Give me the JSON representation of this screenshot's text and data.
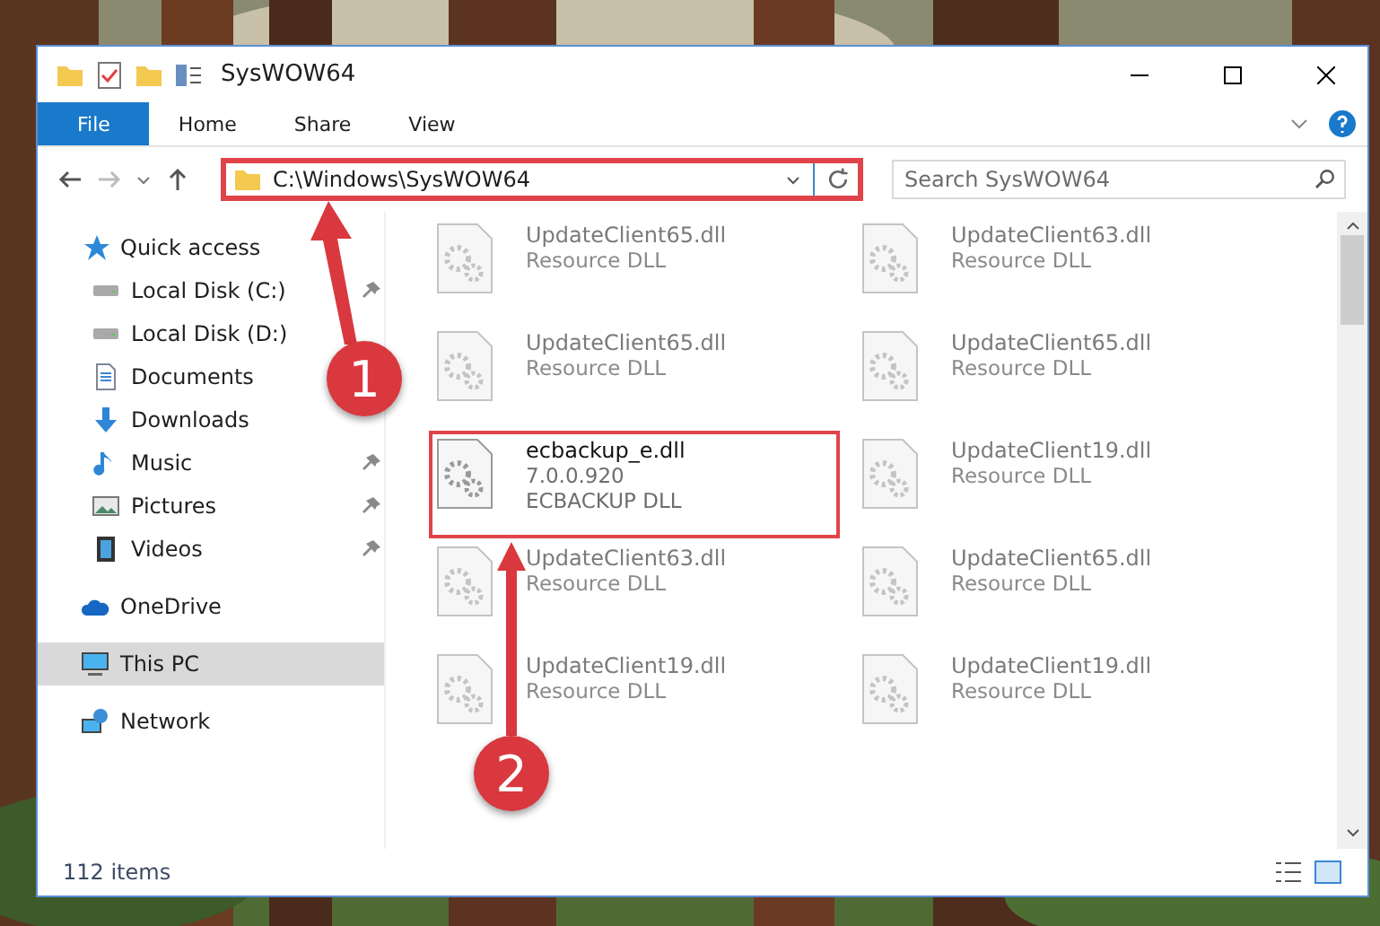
{
  "window": {
    "title": "SysWOW64"
  },
  "ribbon_tabs": [
    {
      "label": "File",
      "kind": "file"
    },
    {
      "label": "Home",
      "kind": "tab"
    },
    {
      "label": "Share",
      "kind": "tab"
    },
    {
      "label": "View",
      "kind": "tab"
    }
  ],
  "address_bar": {
    "path": "C:\\Windows\\SysWOW64",
    "highlighted": true,
    "callout": "1"
  },
  "search": {
    "placeholder": "Search SysWOW64"
  },
  "sidebar": {
    "items": [
      {
        "label": "Quick access",
        "kind": "star",
        "selected": false,
        "children": [
          {
            "label": "Local Disk (C:)",
            "kind": "disk",
            "pinned": true,
            "selected": false
          },
          {
            "label": "Local Disk (D:)",
            "kind": "disk",
            "pinned": false,
            "selected": false
          },
          {
            "label": "Documents",
            "kind": "doc",
            "pinned": false,
            "selected": false
          },
          {
            "label": "Downloads",
            "kind": "download",
            "pinned": false,
            "selected": false
          },
          {
            "label": "Music",
            "kind": "music",
            "pinned": true,
            "selected": false
          },
          {
            "label": "Pictures",
            "kind": "pictures",
            "pinned": true,
            "selected": false
          },
          {
            "label": "Videos",
            "kind": "videos",
            "pinned": true,
            "selected": false
          }
        ]
      },
      {
        "label": "OneDrive",
        "kind": "cloud",
        "selected": false
      },
      {
        "label": "This PC",
        "kind": "pc",
        "selected": true
      },
      {
        "label": "Network",
        "kind": "network",
        "selected": false
      }
    ]
  },
  "files": [
    {
      "name": "UpdateClient65.dll",
      "lines": [
        "Resource DLL"
      ],
      "dimmed": true,
      "highlighted": false
    },
    {
      "name": "UpdateClient63.dll",
      "lines": [
        "Resource DLL"
      ],
      "dimmed": true,
      "highlighted": false
    },
    {
      "name": "UpdateClient65.dll",
      "lines": [
        "Resource DLL"
      ],
      "dimmed": true,
      "highlighted": false
    },
    {
      "name": "UpdateClient65.dll",
      "lines": [
        "Resource DLL"
      ],
      "dimmed": true,
      "highlighted": false
    },
    {
      "name": "ecbackup_e.dll",
      "lines": [
        "7.0.0.920",
        "ECBACKUP DLL"
      ],
      "dimmed": false,
      "highlighted": true,
      "callout": "2"
    },
    {
      "name": "UpdateClient19.dll",
      "lines": [
        "Resource DLL"
      ],
      "dimmed": true,
      "highlighted": false
    },
    {
      "name": "UpdateClient63.dll",
      "lines": [
        "Resource DLL"
      ],
      "dimmed": true,
      "highlighted": false
    },
    {
      "name": "UpdateClient65.dll",
      "lines": [
        "Resource DLL"
      ],
      "dimmed": true,
      "highlighted": false
    },
    {
      "name": "UpdateClient19.dll",
      "lines": [
        "Resource DLL"
      ],
      "dimmed": true,
      "highlighted": false
    },
    {
      "name": "UpdateClient19.dll",
      "lines": [
        "Resource DLL"
      ],
      "dimmed": true,
      "highlighted": false
    }
  ],
  "status_bar": {
    "count": "112 items"
  }
}
